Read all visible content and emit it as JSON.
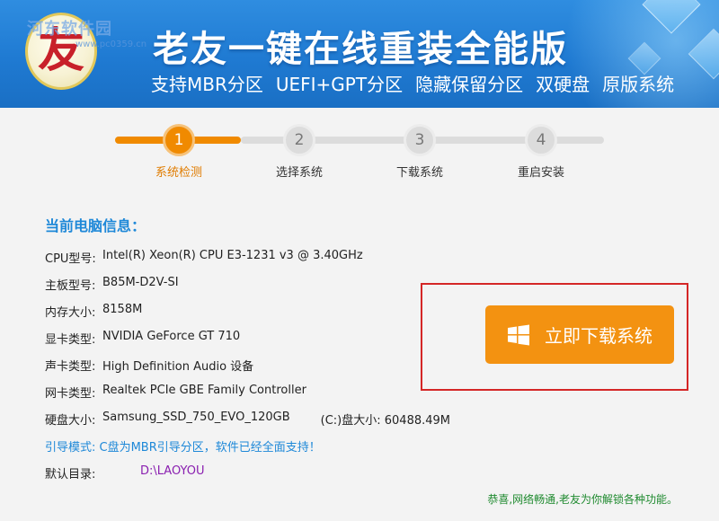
{
  "header": {
    "watermark": "河东软件园",
    "watermark_url": "www.pc0359.cn",
    "logo_glyph": "友",
    "title": "老友一键在线重装全能版",
    "features": [
      "支持MBR分区",
      "UEFI+GPT分区",
      "隐藏保留分区",
      "双硬盘",
      "原版系统"
    ]
  },
  "steps": [
    {
      "number": "1",
      "label": "系统检测",
      "active": true
    },
    {
      "number": "2",
      "label": "选择系统",
      "active": false
    },
    {
      "number": "3",
      "label": "下载系统",
      "active": false
    },
    {
      "number": "4",
      "label": "重启安装",
      "active": false
    }
  ],
  "info": {
    "title": "当前电脑信息：",
    "rows": [
      {
        "label": "CPU型号:",
        "value": "Intel(R) Xeon(R) CPU E3-1231 v3 @ 3.40GHz"
      },
      {
        "label": "主板型号:",
        "value": "B85M-D2V-SI"
      },
      {
        "label": "内存大小:",
        "value": "8158M"
      },
      {
        "label": "显卡类型:",
        "value": "NVIDIA GeForce GT 710"
      },
      {
        "label": "声卡类型:",
        "value": "High Definition Audio 设备"
      },
      {
        "label": "网卡类型:",
        "value": "Realtek PCIe GBE Family Controller"
      },
      {
        "label": "硬盘大小:",
        "value": "Samsung_SSD_750_EVO_120GB",
        "extra": "(C:)盘大小: 60488.49M"
      }
    ],
    "boot_mode": "引导模式: C盘为MBR引导分区，软件已经全面支持！",
    "default_dir_label": "默认目录:",
    "default_dir": "D:\\LAOYOU"
  },
  "download_button": {
    "label": "立即下载系统",
    "icon": "windows-icon"
  },
  "status_message": "恭喜,网络畅通,老友为你解锁各种功能。",
  "colors": {
    "header_blue": "#1f7ad2",
    "accent_orange": "#f39211",
    "info_blue": "#1e88d8",
    "status_green": "#1f8a2f",
    "highlight_red": "#d42626"
  }
}
